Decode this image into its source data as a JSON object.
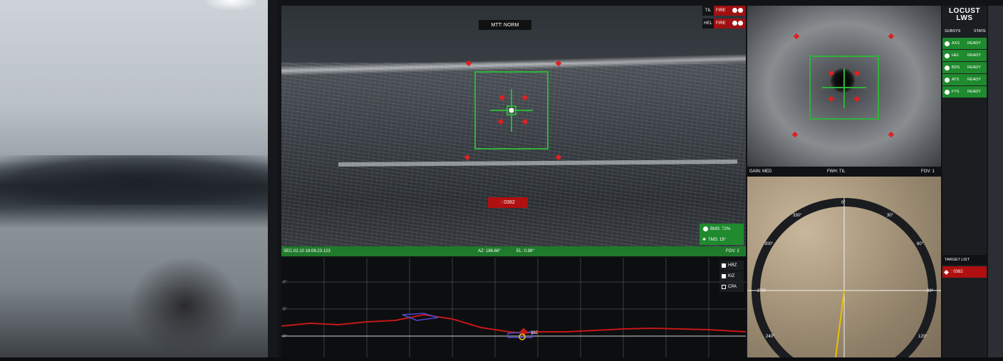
{
  "main_view": {
    "mode_label": "MTT: NORM",
    "target_id": ": 0382",
    "fire_status": [
      {
        "key": "TIL",
        "value": "FIRE"
      },
      {
        "key": "HEL",
        "value": "FIRE"
      }
    ],
    "status": [
      {
        "label": "BMS: 72%"
      },
      {
        "label": "TMS: 19°"
      }
    ],
    "bar": {
      "timestamp": "SEC.02.10 18:08:23.123",
      "az": "AZ: 186.68°",
      "el": "EL: 0.98°",
      "fov": "FOV: 2"
    }
  },
  "graph": {
    "legend": [
      {
        "label": "HRZ",
        "checked": true
      },
      {
        "label": "KIZ",
        "checked": true
      },
      {
        "label": "CPA",
        "checked": false
      }
    ],
    "y_labels": [
      "0°",
      "0°",
      "0°"
    ],
    "marker_label": "382"
  },
  "zoom_view": {
    "bar": {
      "gain": "GAIN: MED",
      "fwh": "FWH: TIL",
      "fov": "FOV: 1"
    }
  },
  "map": {
    "compass": [
      "0°",
      "30°",
      "60°",
      "90°",
      "120°",
      "240°",
      "270°",
      "300°",
      "330°"
    ]
  },
  "panel": {
    "logo_line1": "LOCUST",
    "logo_line2": "LWS",
    "subsys_header": "SUBSYS",
    "state_header": "STATE",
    "subsystems": [
      {
        "name": "AXS",
        "state": "READY"
      },
      {
        "name": "HEL",
        "state": "READY"
      },
      {
        "name": "BDS",
        "state": "READY"
      },
      {
        "name": "ATS",
        "state": "READY"
      },
      {
        "name": "FTS",
        "state": "READY"
      }
    ],
    "target_list_header": "TARGET LIST",
    "target_list_item": ": 0382"
  },
  "colors": {
    "green": "#2fb23a",
    "red": "#b01010",
    "panel_green": "#1f8a2e"
  }
}
